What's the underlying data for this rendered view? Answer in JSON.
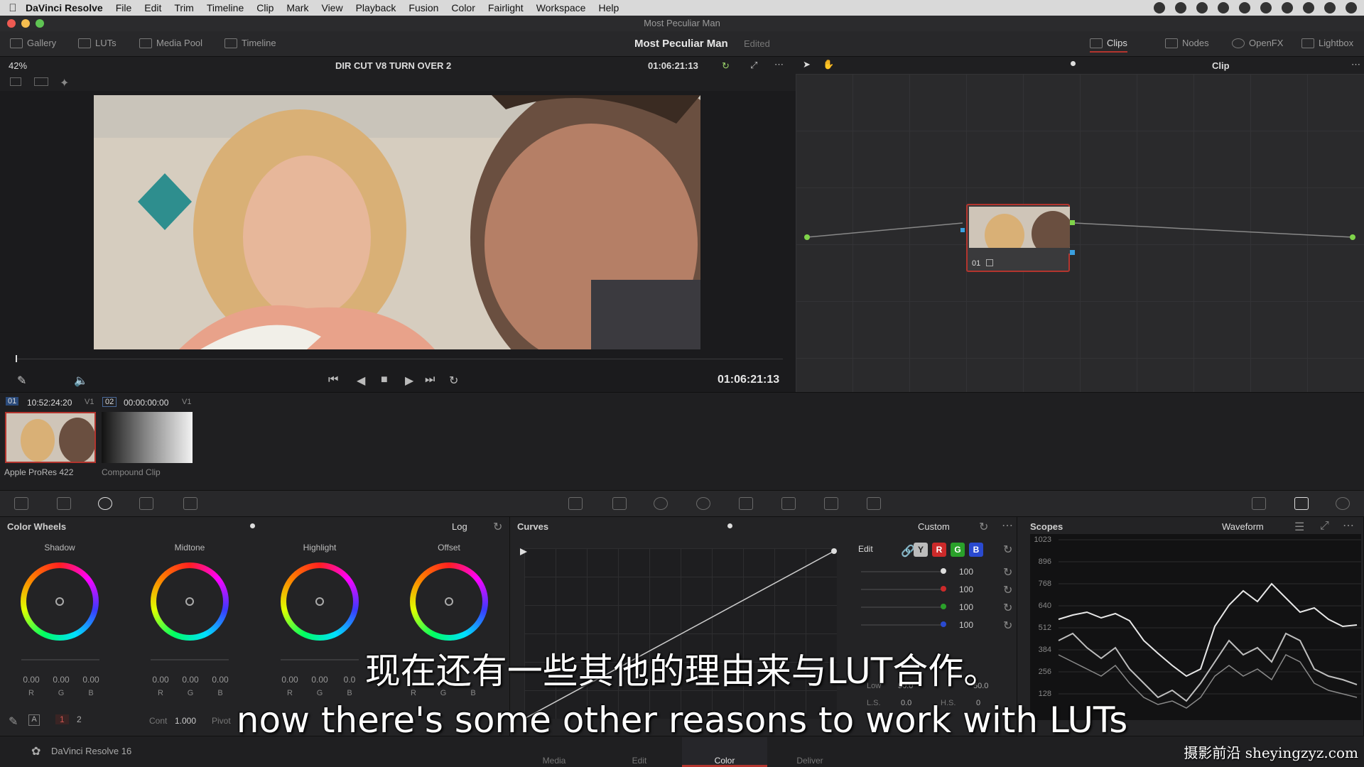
{
  "menubar": {
    "app_name": "DaVinci Resolve",
    "items": [
      "File",
      "Edit",
      "Trim",
      "Timeline",
      "Clip",
      "Mark",
      "View",
      "Playback",
      "Fusion",
      "Color",
      "Fairlight",
      "Workspace",
      "Help"
    ]
  },
  "window": {
    "title": "Most Peculiar Man"
  },
  "toolbar": {
    "gallery": "Gallery",
    "luts": "LUTs",
    "media_pool": "Media Pool",
    "timeline": "Timeline",
    "project_title": "Most Peculiar Man",
    "edited": "Edited",
    "clips": "Clips",
    "nodes": "Nodes",
    "openfx": "OpenFX",
    "lightbox": "Lightbox"
  },
  "viewer": {
    "zoom": "42%",
    "timeline_name": "DIR CUT V8 TURN OVER 2",
    "timecode_top": "01:06:21:13",
    "timecode_main": "01:06:21:13"
  },
  "nodes": {
    "mode": "Clip",
    "node_label": "01"
  },
  "clips": [
    {
      "index": "01",
      "timecode": "10:52:24:20",
      "track": "V1",
      "name": "Apple ProRes 422"
    },
    {
      "index": "02",
      "timecode": "00:00:00:00",
      "track": "V1",
      "name": "Compound Clip"
    }
  ],
  "color_wheels": {
    "title": "Color Wheels",
    "mode": "Log",
    "wheels": [
      {
        "label": "Shadow",
        "values": [
          "0.00",
          "0.00",
          "0.00"
        ]
      },
      {
        "label": "Midtone",
        "values": [
          "0.00",
          "0.00",
          "0.00"
        ]
      },
      {
        "label": "Highlight",
        "values": [
          "0.00",
          "0.00",
          "0.0"
        ]
      },
      {
        "label": "Offset",
        "values": [
          "",
          "",
          ""
        ]
      }
    ],
    "channels": [
      "R",
      "G",
      "B"
    ],
    "footer": {
      "page1": "1",
      "page2": "2",
      "cont_label": "Cont",
      "cont_value": "1.000",
      "pivot_label": "Pivot"
    }
  },
  "curves": {
    "title": "Curves",
    "mode": "Custom",
    "edit_label": "Edit",
    "channel_buttons": [
      "Y",
      "R",
      "G",
      "B"
    ],
    "intensity_values": [
      "100",
      "100",
      "100",
      "100"
    ],
    "low_label": "Low",
    "low_value": "50.0",
    "high_value": "50.0",
    "ls_label": "L.S.",
    "ls_value": "0.0",
    "hs_label": "H.S.",
    "hs_value": "0"
  },
  "scopes": {
    "title": "Scopes",
    "mode": "Waveform",
    "levels": [
      "1023",
      "896",
      "768",
      "640",
      "512",
      "384",
      "256",
      "128"
    ]
  },
  "pages": {
    "app_version": "DaVinci Resolve 16",
    "tabs": [
      "Media",
      "Edit",
      "Color",
      "Deliver"
    ],
    "active": "Color"
  },
  "subtitles": {
    "chinese": "现在还有一些其他的理由来与LUT合作。",
    "english": "now there's some other reasons to work with LUTs"
  },
  "watermark": "摄影前沿 sheyingzyz.com",
  "colors": {
    "accent_red": "#b3352e",
    "node_green": "#7fd34a",
    "node_blue": "#3aa0e0"
  }
}
